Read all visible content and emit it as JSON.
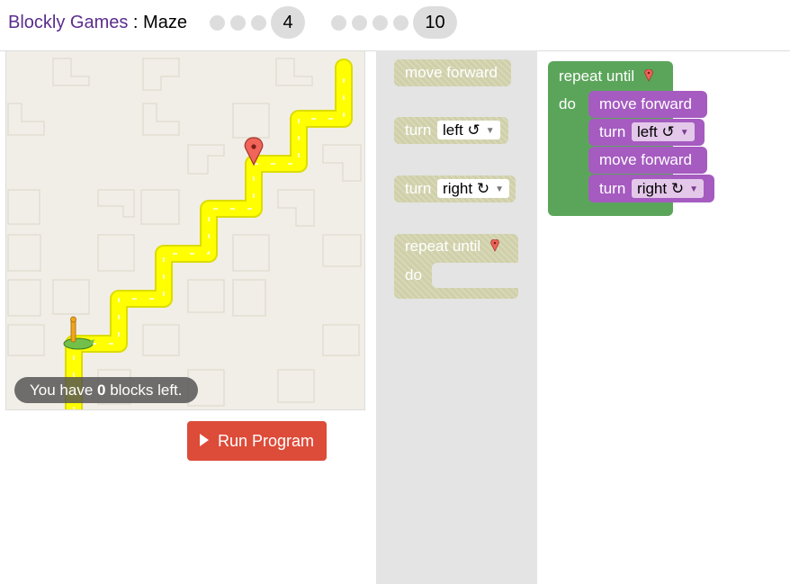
{
  "header": {
    "app_link": "Blockly Games",
    "separator": " : ",
    "game_name": "Maze",
    "levels": [
      {
        "label": "",
        "current": false
      },
      {
        "label": "",
        "current": false
      },
      {
        "label": "",
        "current": false
      },
      {
        "label": "4",
        "current": true
      },
      {
        "label": "",
        "current": false
      },
      {
        "label": "",
        "current": false
      },
      {
        "label": "",
        "current": false
      },
      {
        "label": "",
        "current": false
      },
      {
        "label": "",
        "current": false
      },
      {
        "label": "10",
        "current": false
      }
    ]
  },
  "maze": {
    "capacity_prefix": "You have ",
    "capacity_count": "0",
    "capacity_suffix": " blocks left.",
    "path_color": "#ffff00",
    "background_color": "#f1eee7"
  },
  "run_button": {
    "label": "Run Program",
    "color": "#dd4b39"
  },
  "toolbox": {
    "move_forward": "move forward",
    "turn_label": "turn",
    "turn_left_option": "left ↺",
    "turn_right_option": "right ↻",
    "repeat_until": "repeat until",
    "do_label": "do",
    "block_color": "#cfd0a9"
  },
  "workspace": {
    "repeat_until": "repeat until",
    "do_label": "do",
    "loop_color": "#5ba55b",
    "action_color": "#a55bc0",
    "statements": [
      {
        "kind": "move",
        "label": "move forward"
      },
      {
        "kind": "turn",
        "label": "turn",
        "option": "left ↺"
      },
      {
        "kind": "move",
        "label": "move forward"
      },
      {
        "kind": "turn",
        "label": "turn",
        "option": "right ↻"
      }
    ]
  }
}
